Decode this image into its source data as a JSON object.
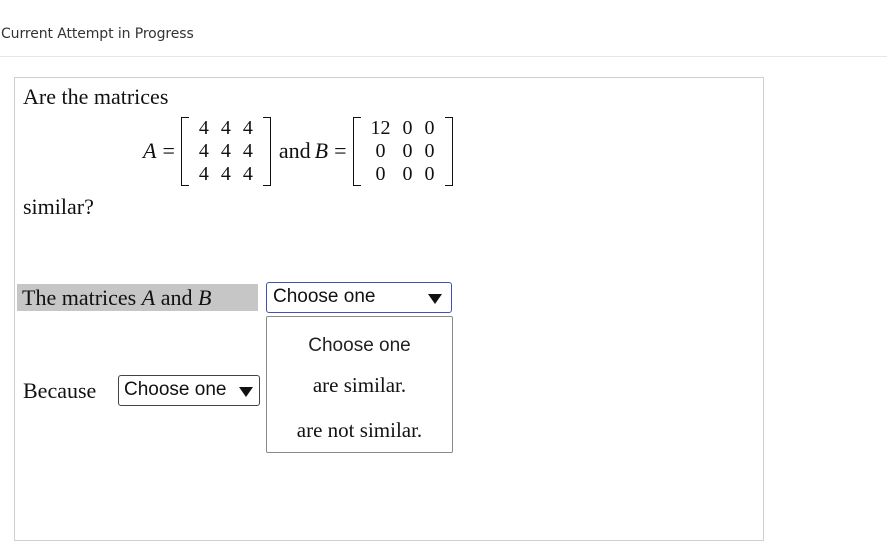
{
  "header": {
    "title": "Current Attempt in Progress"
  },
  "question": {
    "intro": "Are the matrices",
    "matrix_a": {
      "label": "A",
      "eq": "=",
      "rows": [
        [
          "4",
          "4",
          "4"
        ],
        [
          "4",
          "4",
          "4"
        ],
        [
          "4",
          "4",
          "4"
        ]
      ]
    },
    "connector": "and",
    "matrix_b": {
      "label": "B",
      "eq": "=",
      "rows": [
        [
          "12",
          "0",
          "0"
        ],
        [
          "0",
          "0",
          "0"
        ],
        [
          "0",
          "0",
          "0"
        ]
      ]
    },
    "similar": "similar?"
  },
  "answer": {
    "statement_prefix": "The matrices",
    "var_a": "A",
    "connector": "and",
    "var_b": "B",
    "select_value": "Choose one",
    "dropdown_options": [
      "Choose one",
      "are similar.",
      "are not similar."
    ],
    "because_label": "Because",
    "because_select_value": "Choose one"
  }
}
